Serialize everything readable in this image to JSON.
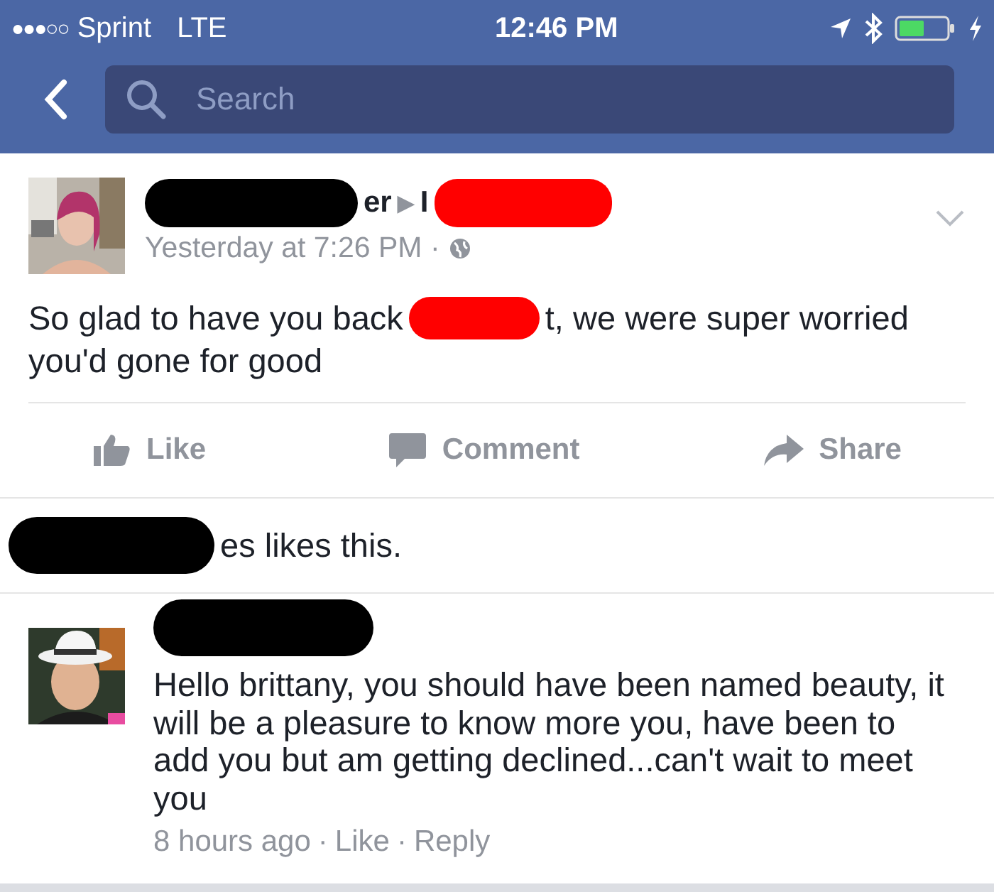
{
  "status_bar": {
    "signal": "●●●○○",
    "carrier": "Sprint",
    "network": "LTE",
    "time": "12:46 PM"
  },
  "nav": {
    "search": {
      "placeholder": "Search"
    }
  },
  "post": {
    "author_segments": [
      {
        "kind": "redaction",
        "color": "#000000"
      },
      {
        "kind": "text",
        "text": "er"
      },
      {
        "kind": "arrow",
        "text": "▶"
      },
      {
        "kind": "text",
        "text": "I"
      },
      {
        "kind": "redaction",
        "color": "#ff0000"
      }
    ],
    "time": "Yesterday at 7:26 PM ·",
    "body_lines": [
      [
        {
          "kind": "text",
          "text": "So glad to have you back"
        },
        {
          "kind": "redaction",
          "color": "#ff0000"
        },
        {
          "kind": "text",
          "text": "t, we were super worried"
        }
      ],
      [
        {
          "kind": "text",
          "text": "you'd gone for good"
        }
      ]
    ],
    "actions": [
      {
        "kind": "like",
        "label": "Like"
      },
      {
        "kind": "comment",
        "label": "Comment"
      },
      {
        "kind": "share",
        "label": "Share"
      }
    ],
    "likes_segments": [
      {
        "kind": "redaction",
        "color": "#000000"
      },
      {
        "kind": "text",
        "text": "es likes this."
      }
    ]
  },
  "comment": {
    "name_redaction": {
      "color": "#000000"
    },
    "text": "Hello brittany, you should have been named beauty, it will be a pleasure to know more you, have been to add you but am getting declined...can't wait to meet you",
    "time": "8 hours ago",
    "meta_links": [
      "Like",
      "Reply"
    ],
    "separator": "·"
  }
}
